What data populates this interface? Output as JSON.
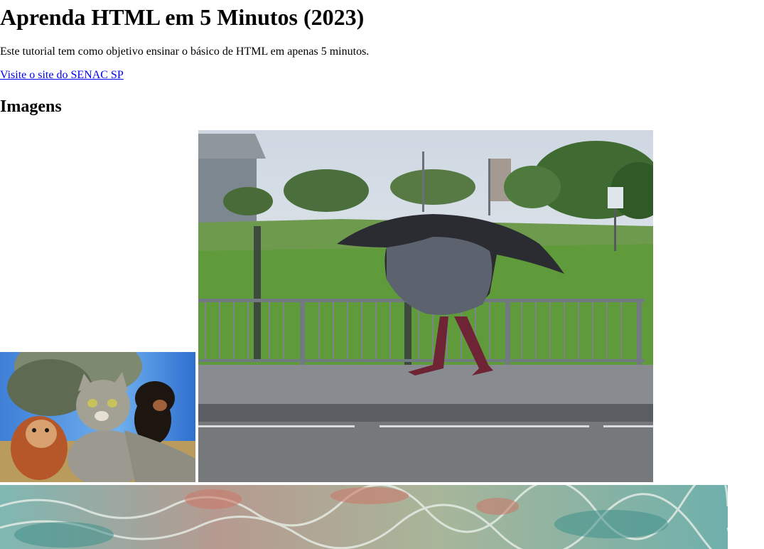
{
  "page": {
    "title": "Aprenda HTML em 5 Minutos (2023)",
    "intro": "Este tutorial tem como objetivo ensinar o básico de HTML em apenas 5 minutos.",
    "link_text": "Visite o site do SENAC SP",
    "section_heading": "Imagens"
  },
  "images": [
    {
      "subject": "cat-and-dogs-selfie-photo"
    },
    {
      "subject": "crow-walking-photo"
    },
    {
      "subject": "underwater-reef-photo"
    }
  ],
  "colors": {
    "link": "#0000ee",
    "text": "#000000",
    "background": "#ffffff"
  }
}
